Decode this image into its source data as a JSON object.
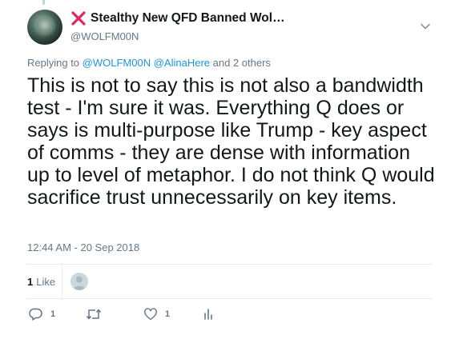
{
  "tweet": {
    "author": {
      "display_name": "Stealthy New QFD Banned Wol…",
      "handle": "@WOLFM00N"
    },
    "reply": {
      "prefix": "Replying to",
      "mention1": "@WOLFM00N",
      "mention2": "@AlinaHere",
      "suffix": "and 2 others"
    },
    "text": "This is not to say this is not also a bandwidth test - I'm sure it was. Everything Q does or says is multi-purpose like Trump - key aspect of comms - they are dense with information up to level of metaphor. I do not think Q would sacrifice trust unnecessarily on key items.",
    "timestamp": "12:44 AM - 20 Sep 2018",
    "stats": {
      "like_count": "1",
      "like_label": "Like"
    },
    "actions": {
      "reply_count": "1",
      "like_count": "1"
    }
  },
  "colors": {
    "text": "#14171a",
    "secondary": "#657786",
    "link": "#1b95e0",
    "divider": "#e6ecf0",
    "x_mark": "#e0245e"
  },
  "icons": [
    "cross-mark-icon",
    "chevron-down-icon",
    "reply-icon",
    "retweet-icon",
    "heart-icon",
    "analytics-icon"
  ]
}
